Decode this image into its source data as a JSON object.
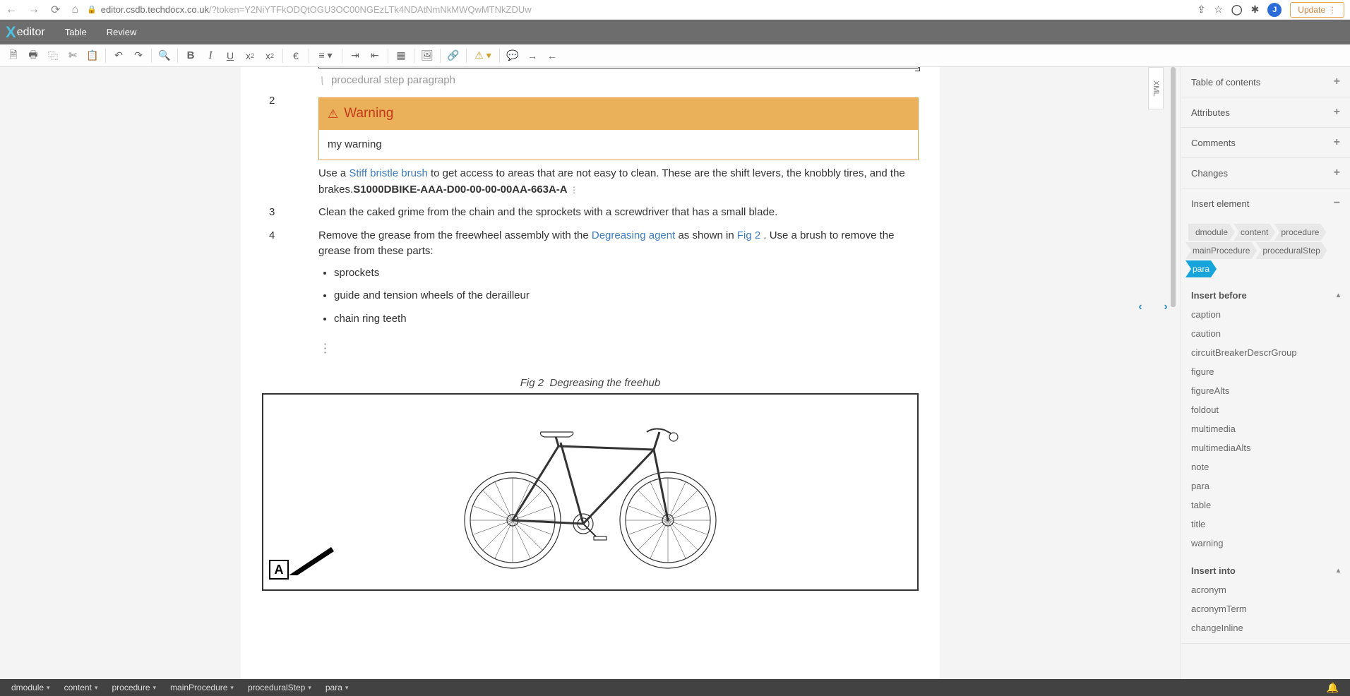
{
  "browser": {
    "url_host": "editor.csdb.techdocx.co.uk",
    "url_path": "/?token=Y2NiYTFkODQtOGU3OC00NGEzLTk4NDAtNmNkMWQwMTNkZDUw",
    "avatar_letter": "J",
    "update_label": "Update"
  },
  "menubar": {
    "logo_prefix": "X",
    "logo_text": "editor",
    "items": [
      "Table",
      "Review"
    ]
  },
  "sidebar": {
    "panels": [
      {
        "title": "Table of contents",
        "icon": "+"
      },
      {
        "title": "Attributes",
        "icon": "+"
      },
      {
        "title": "Comments",
        "icon": "+"
      },
      {
        "title": "Changes",
        "icon": "+"
      },
      {
        "title": "Insert element",
        "icon": "−"
      }
    ],
    "breadcrumb": [
      "dmodule",
      "content",
      "procedure",
      "mainProcedure",
      "proceduralStep",
      "para"
    ],
    "insert_before_label": "Insert before",
    "insert_before": [
      "caption",
      "caution",
      "circuitBreakerDescrGroup",
      "figure",
      "figureAlts",
      "foldout",
      "multimedia",
      "multimediaAlts",
      "note",
      "para",
      "table",
      "title",
      "warning"
    ],
    "insert_into_label": "Insert into",
    "insert_into": [
      "acronym",
      "acronymTerm",
      "changeInline"
    ]
  },
  "xml_tab": "XML",
  "document": {
    "placeholder": "procedural step paragraph",
    "step2": {
      "num": "2",
      "warning_title": "Warning",
      "warning_text": "my warning",
      "para_a": "Use a ",
      "link1": "Stiff bristle brush",
      "para_b": " to get access to areas that are not easy to clean. These are the shift levers, the knobbly tires, and the brakes.",
      "dmcode": "S1000DBIKE-AAA-D00-00-00-00AA-663A-A"
    },
    "step3": {
      "num": "3",
      "text": "Clean the caked grime from the chain and the sprockets with a screwdriver that has a small blade."
    },
    "step4": {
      "num": "4",
      "para_a": "Remove the grease from the freewheel assembly with the ",
      "link1": "Degreasing agent",
      "para_b": " as shown in ",
      "link2": "Fig 2",
      "para_c": " . Use a brush to remove the grease from these parts:",
      "items": [
        "sprockets",
        "guide and tension wheels of the derailleur",
        "chain ring teeth"
      ]
    },
    "figure": {
      "label": "Fig 2",
      "title": "Degreasing the freehub",
      "callout": "A"
    }
  },
  "statusbar": {
    "path": [
      "dmodule",
      "content",
      "procedure",
      "mainProcedure",
      "proceduralStep",
      "para"
    ]
  }
}
